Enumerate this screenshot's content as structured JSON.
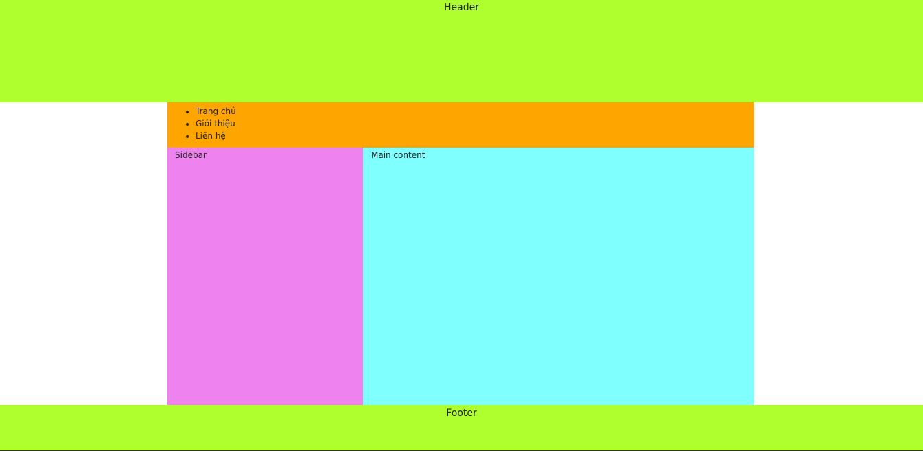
{
  "colors": {
    "header_bg": "#afff2f",
    "nav_bg": "#ffa500",
    "sidebar_bg": "#ee82ee",
    "main_bg": "#80ffff",
    "footer_bg": "#afff2f"
  },
  "header": {
    "title": "Header"
  },
  "nav": {
    "items": [
      {
        "label": "Trang chủ"
      },
      {
        "label": "Giới thiệu"
      },
      {
        "label": "Liên hệ"
      }
    ]
  },
  "sidebar": {
    "label": "Sidebar"
  },
  "main": {
    "label": "Main content"
  },
  "footer": {
    "label": "Footer"
  }
}
